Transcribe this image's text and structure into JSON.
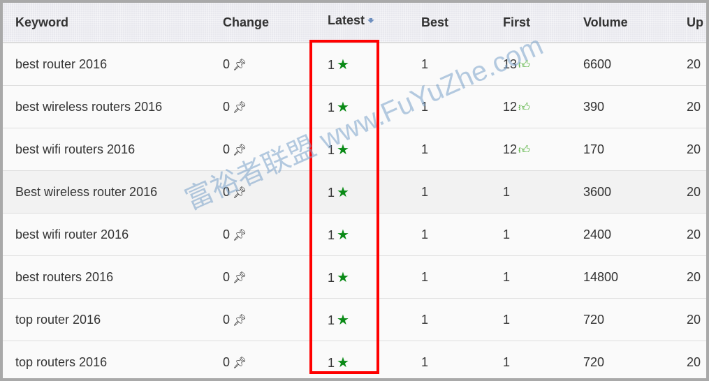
{
  "columns": [
    "Keyword",
    "Change",
    "Latest",
    "Best",
    "First",
    "Volume",
    "Up"
  ],
  "rows": [
    {
      "keyword": "best router 2016",
      "change": "0",
      "latest": "1",
      "best": "1",
      "first": "13",
      "first_icon": "thumbs-up",
      "volume": "6600",
      "updated": "20"
    },
    {
      "keyword": "best wireless routers 2016",
      "change": "0",
      "latest": "1",
      "best": "1",
      "first": "12",
      "first_icon": "thumbs-up",
      "volume": "390",
      "updated": "20"
    },
    {
      "keyword": "best wifi routers 2016",
      "change": "0",
      "latest": "1",
      "best": "1",
      "first": "12",
      "first_icon": "thumbs-up",
      "volume": "170",
      "updated": "20"
    },
    {
      "keyword": "Best wireless router 2016",
      "change": "0",
      "latest": "1",
      "best": "1",
      "first": "1",
      "first_icon": "",
      "volume": "3600",
      "updated": "20"
    },
    {
      "keyword": "best wifi router 2016",
      "change": "0",
      "latest": "1",
      "best": "1",
      "first": "1",
      "first_icon": "",
      "volume": "2400",
      "updated": "20"
    },
    {
      "keyword": "best routers 2016",
      "change": "0",
      "latest": "1",
      "best": "1",
      "first": "1",
      "first_icon": "",
      "volume": "14800",
      "updated": "20"
    },
    {
      "keyword": "top router 2016",
      "change": "0",
      "latest": "1",
      "best": "1",
      "first": "1",
      "first_icon": "",
      "volume": "720",
      "updated": "20"
    },
    {
      "keyword": "top routers 2016",
      "change": "0",
      "latest": "1",
      "best": "1",
      "first": "1",
      "first_icon": "",
      "volume": "720",
      "updated": "20"
    }
  ],
  "icons": {
    "change": "pushpin-icon",
    "latest": "star-icon",
    "sort": "sort-down-arrow-icon",
    "first": "thumbs-up-icon"
  },
  "colors": {
    "star": "#0a8a16",
    "highlight": "#ff0000",
    "thumb": "#3aa51e"
  },
  "watermark": "富裕者联盟 www.FuYuZhe.com"
}
